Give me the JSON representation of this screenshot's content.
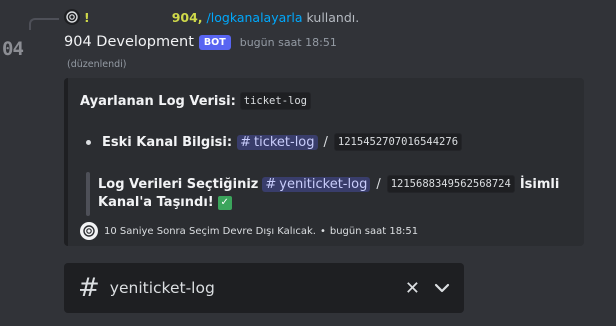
{
  "reply": {
    "excl": "!",
    "user": "904,",
    "command": "/logkanalayarla",
    "used_text": "kullandı."
  },
  "avatar_fragment": "04",
  "message": {
    "username": "904 Development",
    "bot_tag": "BOT",
    "timestamp": "bugün saat 18:51",
    "edited": "(düzenlendi)"
  },
  "embed": {
    "title_label": "Ayarlanan Log Verisi:",
    "title_code": "ticket-log",
    "old_label": "Eski Kanal Bilgisi:",
    "old_channel": "ticket-log",
    "old_separator": "/",
    "old_id": "1215452707016544276",
    "quote_line1_label": "Log Verileri Seçtiğiniz",
    "new_channel": "yeniticket-log",
    "new_separator": "/",
    "new_id": "1215688349562568724",
    "quote_line1_suffix": "İsimli",
    "quote_line2": "Kanal'a Taşındı!",
    "check_icon": "white-check-mark",
    "footer_text": "10 Saniye Sonra Seçim Devre Dışı Kalıcak.",
    "footer_dot": "•",
    "footer_time": "bugün saat 18:51"
  },
  "channel_select": {
    "hash": "#",
    "value": "yeniticket-log",
    "clear": "✕"
  },
  "colors": {
    "background": "#313338",
    "embed_bg": "#2b2d31",
    "mention": "#5865f2",
    "reply_user": "#cfd94a",
    "command_link": "#00a8fc"
  }
}
